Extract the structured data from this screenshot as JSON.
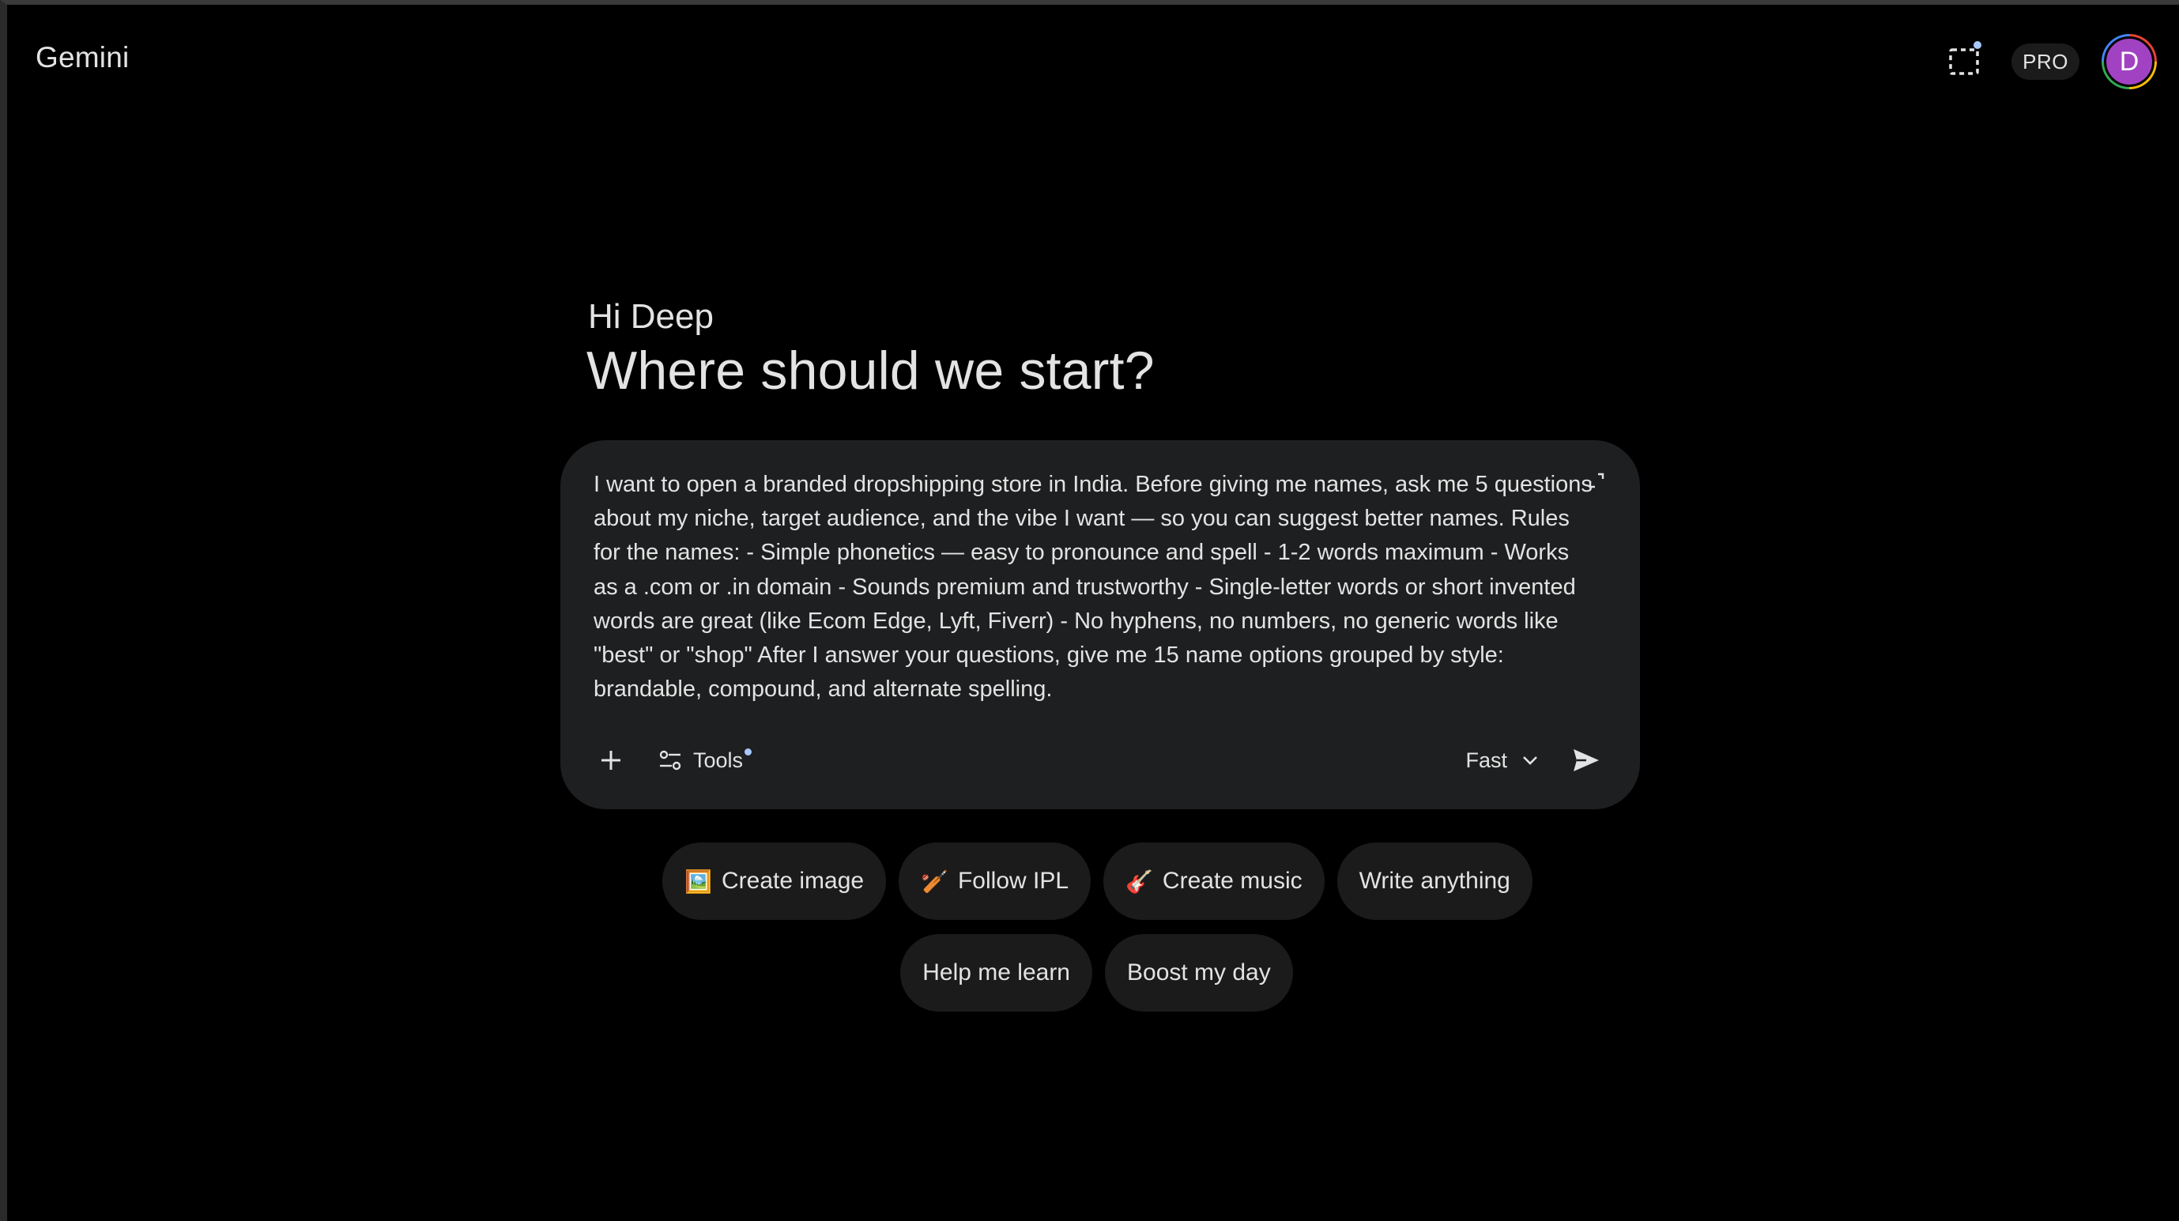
{
  "header": {
    "brand": "Gemini",
    "pro_label": "PRO",
    "avatar_initial": "D",
    "avatar_color": "#a142c2"
  },
  "hero": {
    "greeting": "Hi Deep",
    "headline": "Where should we start?"
  },
  "composer": {
    "prompt_text": "I want to open a branded dropshipping store in India. Before giving me names, ask me 5 questions about my niche, target audience, and the vibe I want — so you can suggest better names. Rules for the names: - Simple phonetics — easy to pronounce and spell - 1-2 words maximum - Works as a .com or .in domain - Sounds premium and trustworthy - Single-letter words or short invented words are great (like Ecom Edge, Lyft, Fiverr) - No hyphens, no numbers, no generic words like \"best\" or \"shop\" After I answer your questions, give me 15 name options grouped by style: brandable, compound, and alternate spelling.",
    "tools_label": "Tools",
    "mode_label": "Fast",
    "icons": {
      "add": "plus-icon",
      "tools": "tune-icon",
      "mode": "chevron-down-icon",
      "send": "send-icon",
      "expand": "expand-icon"
    }
  },
  "suggestions": {
    "row1": [
      {
        "emoji": "🖼️",
        "label": "Create image"
      },
      {
        "emoji": "🏏",
        "label": "Follow IPL"
      },
      {
        "emoji": "🎸",
        "label": "Create music"
      },
      {
        "emoji": "",
        "label": "Write anything"
      }
    ],
    "row2": [
      {
        "emoji": "",
        "label": "Help me learn"
      },
      {
        "emoji": "",
        "label": "Boost my day"
      }
    ]
  },
  "colors": {
    "background": "#000000",
    "surface": "#1e1f20",
    "chip": "#1b1b1c",
    "text": "#e3e3e3",
    "accent_dot": "#a8c7fa"
  }
}
